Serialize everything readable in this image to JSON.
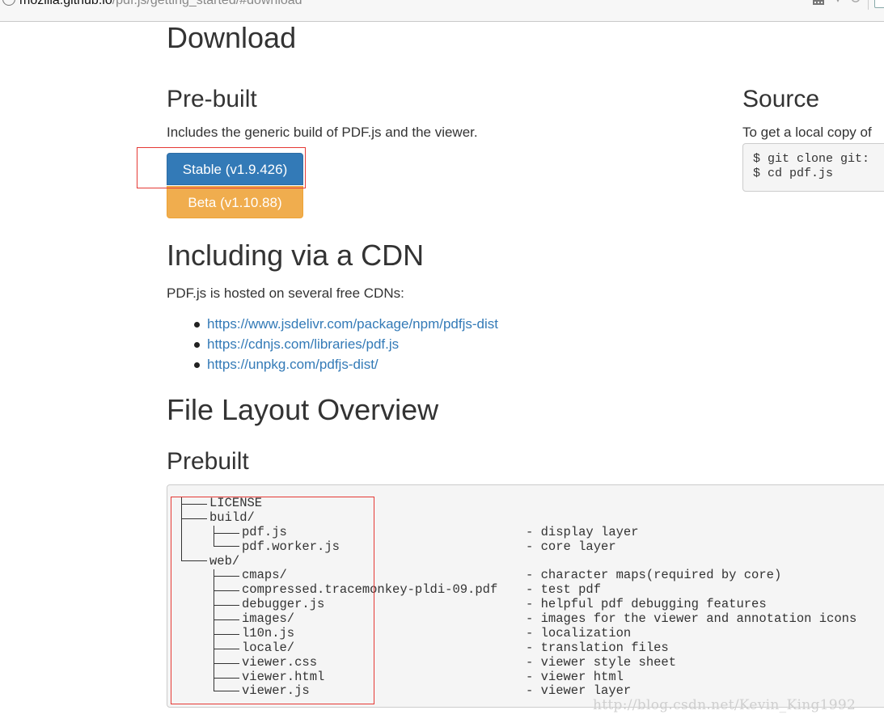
{
  "browser": {
    "url_host": "mozilla.github.io",
    "url_path": "/pdf.js/getting_started/#download"
  },
  "download": {
    "title": "Download",
    "prebuilt": {
      "title": "Pre-built",
      "description": "Includes the generic build of PDF.js and the viewer.",
      "stable_label": "Stable (v1.9.426)",
      "beta_label": "Beta (v1.10.88)",
      "stable_color": "#337ab7",
      "beta_color": "#f0ad4e"
    },
    "source": {
      "title": "Source",
      "description": "To get a local copy of",
      "code_line_1": "$ git clone git:",
      "code_line_2": "$ cd pdf.js"
    }
  },
  "cdn": {
    "title": "Including via a CDN",
    "description": "PDF.js is hosted on several free CDNs:",
    "links": [
      "https://www.jsdelivr.com/package/npm/pdfjs-dist",
      "https://cdnjs.com/libraries/pdf.js",
      "https://unpkg.com/pdfjs-dist/"
    ]
  },
  "file_layout": {
    "title": "File Layout Overview",
    "subtitle": "Prebuilt",
    "tree": [
      {
        "name": "LICENSE",
        "desc": ""
      },
      {
        "name": "build/",
        "desc": ""
      },
      {
        "name": "pdf.js",
        "desc": "- display layer"
      },
      {
        "name": "pdf.worker.js",
        "desc": "- core layer"
      },
      {
        "name": "web/",
        "desc": ""
      },
      {
        "name": "cmaps/",
        "desc": "- character maps(required by core)"
      },
      {
        "name": "compressed.tracemonkey-pldi-09.pdf",
        "desc": "- test pdf"
      },
      {
        "name": "debugger.js",
        "desc": "- helpful pdf debugging features"
      },
      {
        "name": "images/",
        "desc": "- images for the viewer and annotation icons"
      },
      {
        "name": "l10n.js",
        "desc": "- localization"
      },
      {
        "name": "locale/",
        "desc": "- translation files"
      },
      {
        "name": "viewer.css",
        "desc": "- viewer style sheet"
      },
      {
        "name": "viewer.html",
        "desc": "- viewer html"
      },
      {
        "name": "viewer.js",
        "desc": "- viewer layer"
      }
    ]
  },
  "watermark": "http://blog.csdn.net/Kevin_King1992"
}
